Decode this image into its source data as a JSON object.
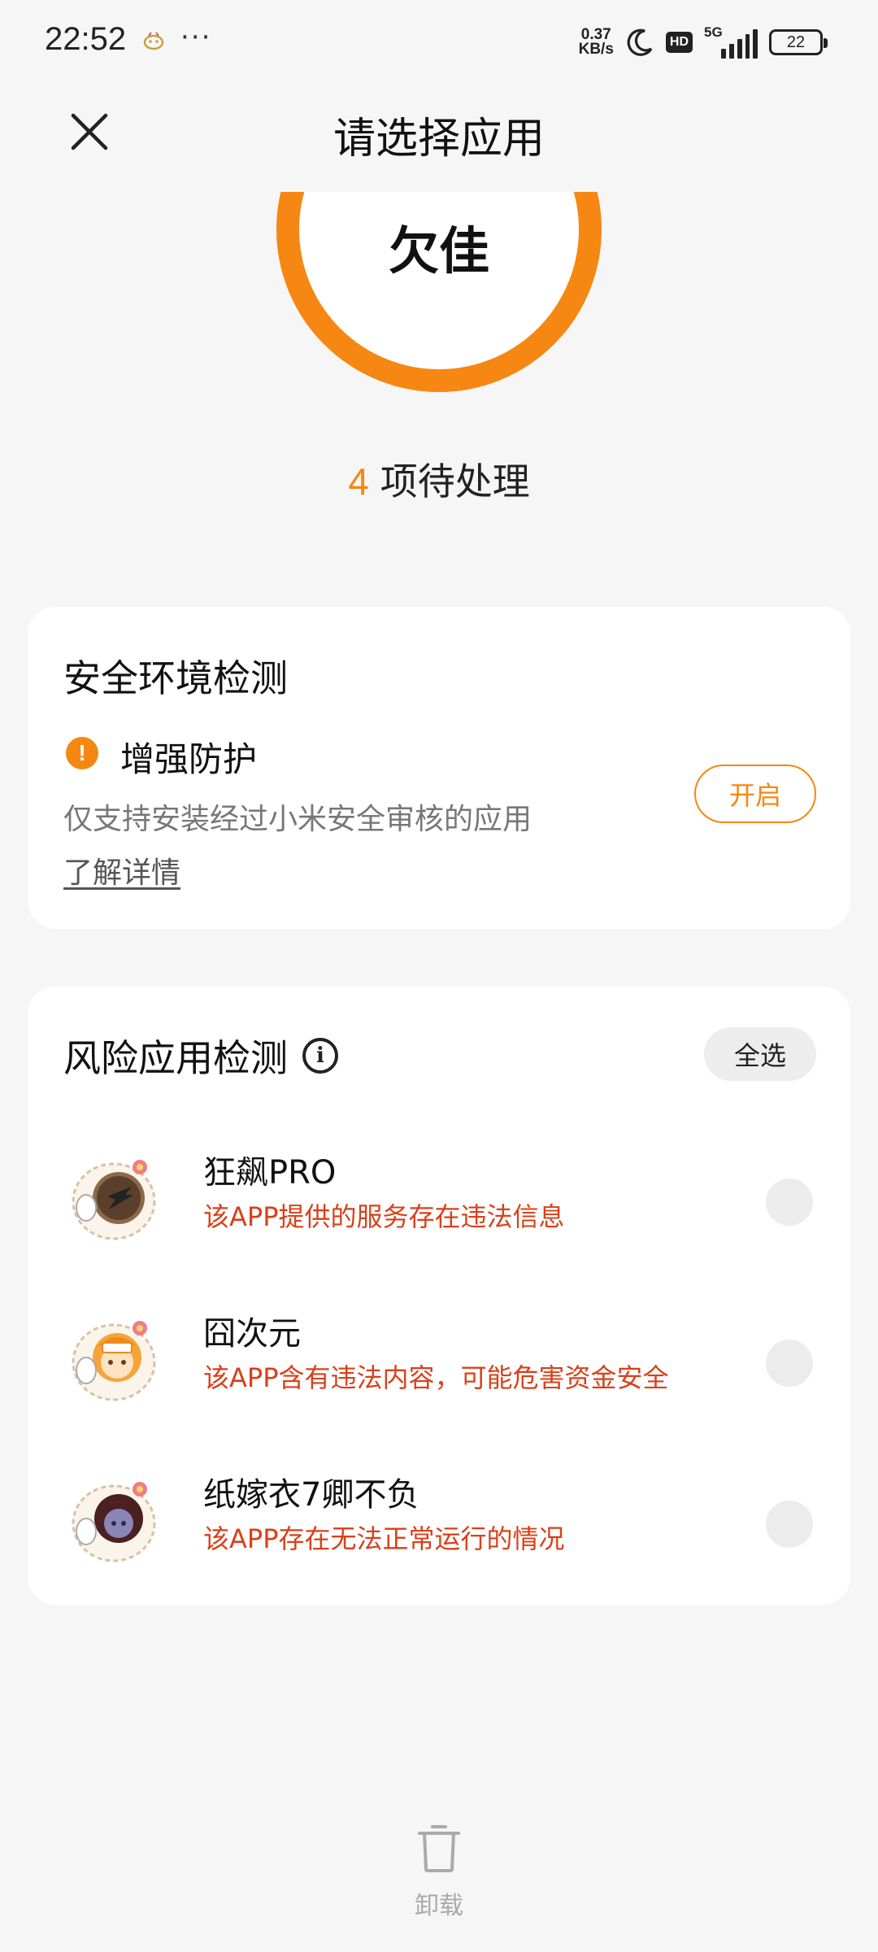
{
  "status_bar": {
    "time": "22:52",
    "dots": "···",
    "net_speed_value": "0.37",
    "net_speed_unit": "KB/s",
    "hd": "HD",
    "network": "5G",
    "battery": "22"
  },
  "header": {
    "title": "请选择应用"
  },
  "score": {
    "label": "欠佳",
    "ring_color": "#f68712"
  },
  "pending": {
    "count": "4",
    "text": "项待处理"
  },
  "security_env": {
    "title": "安全环境检测",
    "item_title": "增强防护",
    "item_desc": "仅支持安装经过小米安全审核的应用",
    "learn_more": "了解详情",
    "open_label": "开启"
  },
  "risk_apps": {
    "title": "风险应用检测",
    "select_all": "全选",
    "items": [
      {
        "name": "狂飙PRO",
        "warning": "该APP提供的服务存在违法信息"
      },
      {
        "name": "囧次元",
        "warning": "该APP含有违法内容，可能危害资金安全"
      },
      {
        "name": "纸嫁衣7卿不负",
        "warning": "该APP存在无法正常运行的情况"
      }
    ]
  },
  "bottom": {
    "uninstall_label": "卸载"
  },
  "colors": {
    "accent": "#f68712",
    "warning_text": "#d8401a",
    "background": "#f6f6f6"
  }
}
